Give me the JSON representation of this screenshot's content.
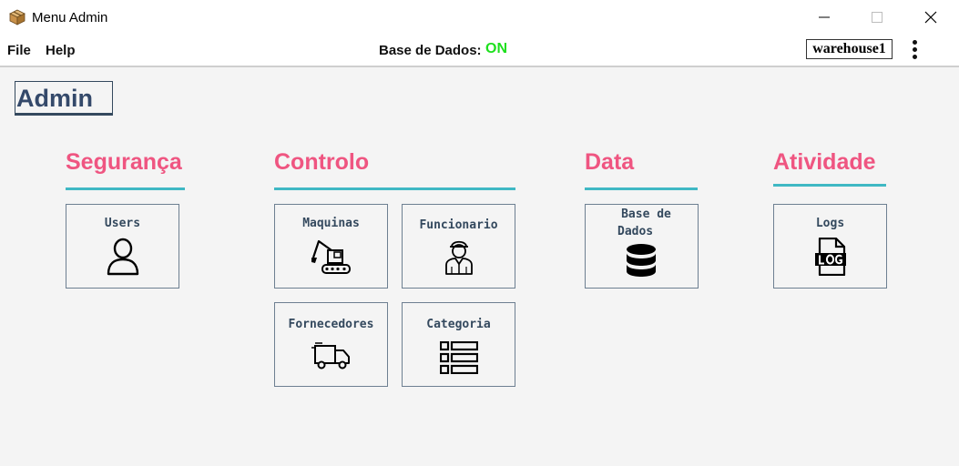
{
  "window": {
    "title": "Menu Admin"
  },
  "menu": {
    "file": "File",
    "help": "Help"
  },
  "database": {
    "label": "Base de Dados:",
    "status": "ON",
    "status_color": "#1ee01e"
  },
  "warehouse": {
    "value": "warehouse1"
  },
  "page": {
    "title": "Admin"
  },
  "colors": {
    "section_title": "#ef5581",
    "underline": "#3fb8c4",
    "card_text": "#34495e"
  },
  "sections": {
    "seguranca": {
      "title": "Segurança",
      "cards": {
        "users": {
          "label": "Users",
          "icon": "user-icon"
        }
      }
    },
    "controlo": {
      "title": "Controlo",
      "cards": {
        "maquinas": {
          "label": "Maquinas",
          "icon": "excavator-icon"
        },
        "funcionario": {
          "label": "Funcionario",
          "icon": "worker-icon"
        },
        "fornecedores": {
          "label": "Fornecedores",
          "icon": "truck-icon"
        },
        "categoria": {
          "label": "Categoria",
          "icon": "list-icon"
        }
      }
    },
    "data": {
      "title": "Data",
      "cards": {
        "base_dados": {
          "label1": "Base de",
          "label2": "Dados",
          "icon": "database-icon"
        }
      }
    },
    "atividade": {
      "title": "Atividade",
      "cards": {
        "logs": {
          "label": "Logs",
          "icon": "log-file-icon"
        }
      }
    }
  }
}
